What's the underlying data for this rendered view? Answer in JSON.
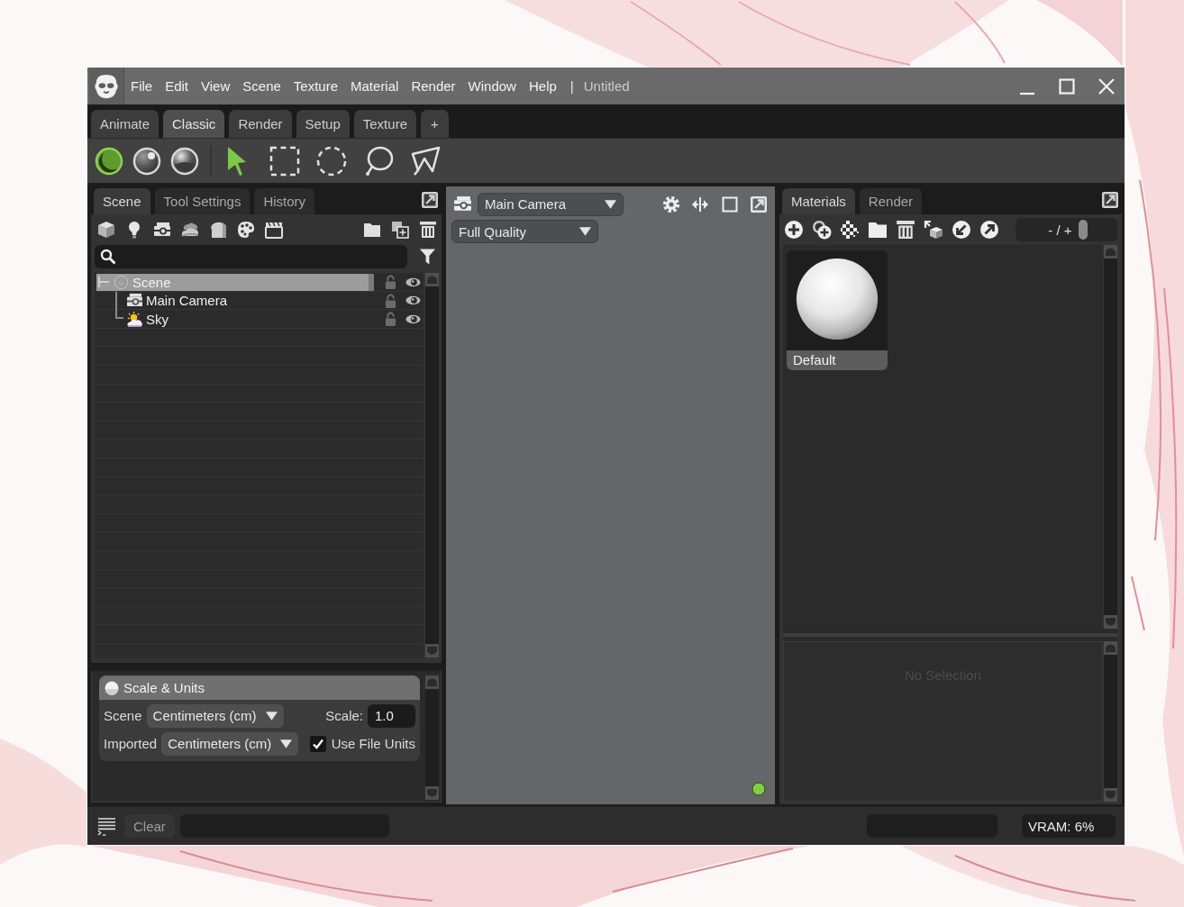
{
  "title_bar": {
    "menu": [
      "File",
      "Edit",
      "View",
      "Scene",
      "Texture",
      "Material",
      "Render",
      "Window",
      "Help"
    ],
    "separator": "|",
    "document_title": "Untitled"
  },
  "workspace_tabs": {
    "tabs": [
      {
        "label": "Animate",
        "selected": false
      },
      {
        "label": "Classic",
        "selected": true
      },
      {
        "label": "Render",
        "selected": false
      },
      {
        "label": "Setup",
        "selected": false
      },
      {
        "label": "Texture",
        "selected": false
      }
    ],
    "add_label": "+"
  },
  "toolbar": {
    "shading_modes": [
      {
        "kind": "flat",
        "selected": true
      },
      {
        "kind": "shaded",
        "selected": false
      },
      {
        "kind": "glossy",
        "selected": false
      }
    ],
    "tools": [
      {
        "kind": "pointer",
        "selected": true
      },
      {
        "kind": "rect",
        "selected": false
      },
      {
        "kind": "ellipse",
        "selected": false
      },
      {
        "kind": "lasso",
        "selected": false
      },
      {
        "kind": "polygon",
        "selected": false
      }
    ]
  },
  "scene_panel": {
    "tabs": [
      {
        "label": "Scene",
        "selected": true
      },
      {
        "label": "Tool Settings",
        "selected": false
      },
      {
        "label": "History",
        "selected": false
      }
    ],
    "tree": [
      {
        "kind": "root",
        "label": "Scene",
        "selected": true,
        "expanded": true,
        "locked": false,
        "visible": true,
        "children": [
          {
            "kind": "camera",
            "label": "Main Camera",
            "selected": false,
            "locked": false,
            "visible": true
          },
          {
            "kind": "sky",
            "label": "Sky",
            "selected": false,
            "locked": false,
            "visible": true
          }
        ]
      }
    ]
  },
  "scale_units": {
    "title": "Scale & Units",
    "scene_label": "Scene",
    "scene_units": "Centimeters (cm)",
    "scale_label": "Scale:",
    "scale_value": "1.0",
    "imported_label": "Imported",
    "imported_units": "Centimeters (cm)",
    "use_file_units": {
      "label": "Use File Units",
      "checked": true
    }
  },
  "viewport": {
    "camera": "Main Camera",
    "quality": "Full Quality"
  },
  "materials_panel": {
    "tabs": [
      {
        "label": "Materials",
        "selected": true
      },
      {
        "label": "Render",
        "selected": false
      }
    ],
    "size_slider": {
      "label": "- / +",
      "level": 0.66
    },
    "materials": [
      {
        "name": "Default",
        "selected": true
      }
    ],
    "properties_message": "No Selection"
  },
  "status_bar": {
    "clear_label": "Clear",
    "vram": "VRAM: 6%"
  }
}
